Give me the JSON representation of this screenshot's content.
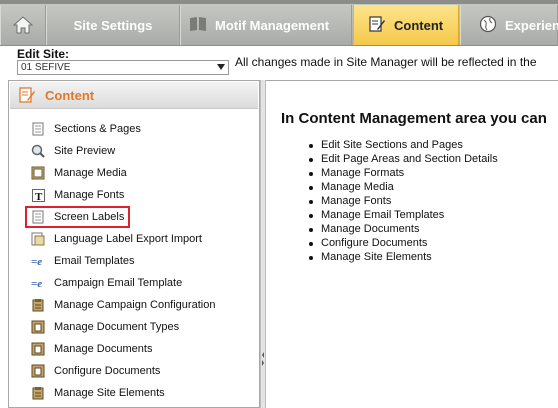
{
  "tabs": {
    "home_icon": "home-icon",
    "site_settings": "Site Settings",
    "motif_management": "Motif Management",
    "content": "Content",
    "experience": "Experien"
  },
  "edit_site": {
    "label": "Edit Site:",
    "selected": "01 SEFIVE",
    "notice": "All changes made in Site Manager will be reflected in the"
  },
  "left_panel": {
    "title": "Content",
    "items": [
      {
        "label": "Sections & Pages",
        "icon": "page-icon"
      },
      {
        "label": "Site Preview",
        "icon": "magnifier-icon"
      },
      {
        "label": "Manage Media",
        "icon": "media-icon"
      },
      {
        "label": "Manage Fonts",
        "icon": "font-icon"
      },
      {
        "label": "Screen Labels",
        "icon": "page-icon",
        "selected": true
      },
      {
        "label": "Language Label Export Import",
        "icon": "language-icon"
      },
      {
        "label": "Email Templates",
        "icon": "email-icon"
      },
      {
        "label": "Campaign Email Template",
        "icon": "email-icon"
      },
      {
        "label": "Manage Campaign Configuration",
        "icon": "document-stack-icon"
      },
      {
        "label": "Manage Document Types",
        "icon": "document-stack-icon"
      },
      {
        "label": "Manage Documents",
        "icon": "document-stack-icon"
      },
      {
        "label": "Configure Documents",
        "icon": "document-stack-icon"
      },
      {
        "label": "Manage Site Elements",
        "icon": "document-stack-icon"
      }
    ]
  },
  "right_panel": {
    "title": "In Content Management area you can",
    "items": [
      "Edit Site Sections and Pages",
      "Edit Page Areas and Section Details",
      "Manage Formats",
      "Manage Media",
      "Manage Fonts",
      "Manage Email Templates",
      "Manage Documents",
      "Configure Documents",
      "Manage Site Elements"
    ]
  },
  "colors": {
    "active_tab": "#f4c94a",
    "accent": "#e07a2a",
    "selection_outline": "#d9232e"
  }
}
